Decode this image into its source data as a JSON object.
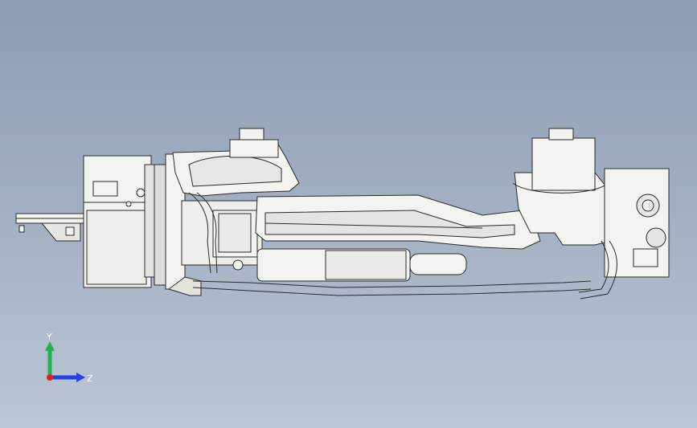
{
  "viewport": {
    "background_top": "#8e9cb3",
    "background_bottom": "#bcc6d4"
  },
  "model": {
    "name": "robot-arm-assembly",
    "line_color": "#2a2a2a",
    "fill_color": "#f3f3f0",
    "shade_color": "#d9dad6"
  },
  "triad": {
    "y_label": "Y",
    "z_label": "Z",
    "y_color": "#22b14c",
    "z_color": "#2244dd",
    "x_color": "#e02020"
  }
}
